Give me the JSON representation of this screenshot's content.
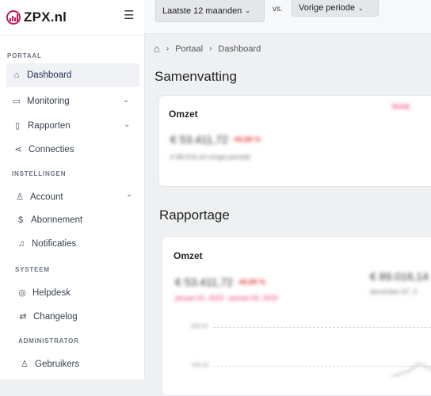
{
  "brand": {
    "name": "ZPX.nl",
    "accent": "#c2185b"
  },
  "sidebar": {
    "sections": {
      "portaal": "PORTAAL",
      "instellingen": "INSTELLINGEN",
      "systeem": "SYSTEEM",
      "administrator": "ADMINISTRATOR"
    },
    "items": [
      {
        "label": "Dashboard",
        "icon": "home-icon"
      },
      {
        "label": "Monitoring",
        "icon": "monitor-icon"
      },
      {
        "label": "Rapporten",
        "icon": "clipboard-icon"
      },
      {
        "label": "Connecties",
        "icon": "share-icon"
      },
      {
        "label": "Account",
        "icon": "user-icon"
      },
      {
        "label": "Abonnement",
        "icon": "dollar-icon"
      },
      {
        "label": "Notificaties",
        "icon": "bell-icon"
      },
      {
        "label": "Helpdesk",
        "icon": "help-icon"
      },
      {
        "label": "Changelog",
        "icon": "refresh-icon"
      },
      {
        "label": "Gebruikers",
        "icon": "user-icon"
      }
    ]
  },
  "topbar": {
    "period": "Laatste 12 maanden",
    "vs": "vs.",
    "compare": "Vorige periode"
  },
  "breadcrumb": {
    "portal": "Portaal",
    "current": "Dashboard"
  },
  "summary": {
    "title": "Samenvatting",
    "card_title": "Omzet",
    "value": "€ 53.411,72",
    "change": "-40,89 %",
    "previous": "€ 89.016,14 vorige periode",
    "link": "Bekijk"
  },
  "report": {
    "title": "Rapportage",
    "card_title": "Omzet",
    "value": "€ 53.411,72",
    "change": "-40,89 %",
    "range": "januari 01, 2023 - januari 05, 2024",
    "compare_value": "€ 89.016,14",
    "compare_range": "december 07, 2",
    "y_ticks": [
      "600.00",
      "500.00"
    ]
  }
}
